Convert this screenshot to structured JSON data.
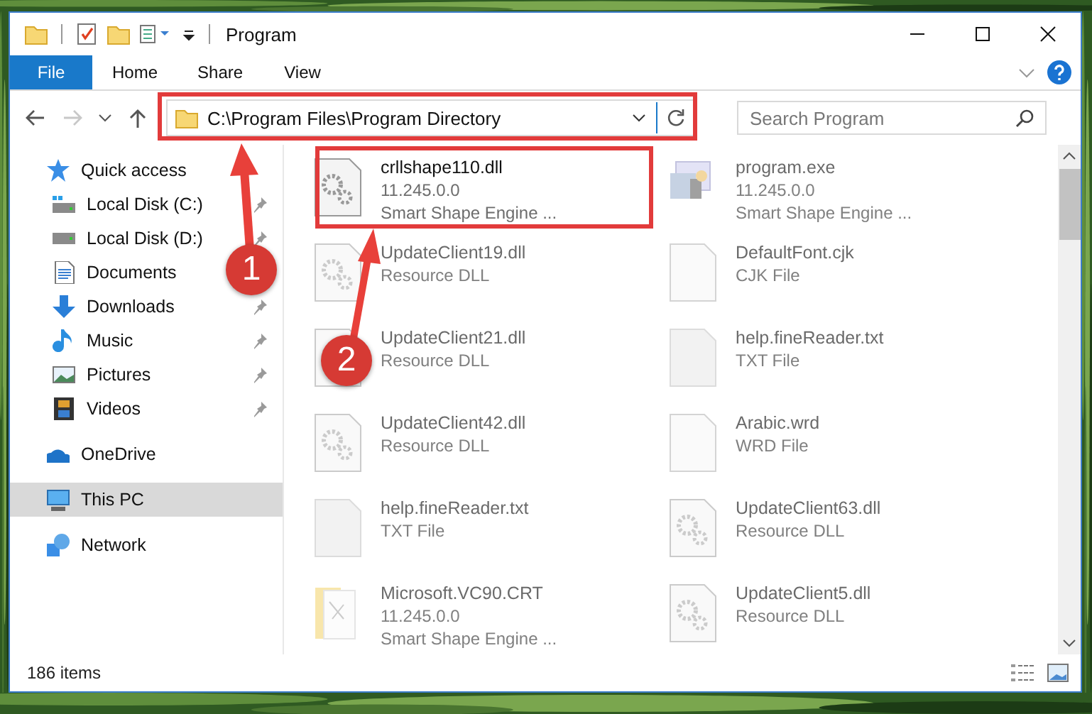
{
  "window": {
    "title": "Program"
  },
  "ribbon": {
    "tabs": [
      {
        "label": "File",
        "selected": true
      },
      {
        "label": "Home",
        "selected": false
      },
      {
        "label": "Share",
        "selected": false
      },
      {
        "label": "View",
        "selected": false
      }
    ]
  },
  "address_bar": {
    "path": "C:\\Program Files\\Program Directory"
  },
  "search": {
    "placeholder": "Search Program"
  },
  "sidebar": {
    "items": [
      {
        "label": "Quick access",
        "kind": "star",
        "selected": false,
        "children": [
          {
            "label": "Local Disk (C:)",
            "kind": "drive-windows",
            "pinned": true,
            "selected": false
          },
          {
            "label": "Local Disk (D:)",
            "kind": "drive",
            "pinned": true,
            "selected": false
          },
          {
            "label": "Documents",
            "kind": "documents",
            "pinned": false,
            "selected": false
          },
          {
            "label": "Downloads",
            "kind": "downloads",
            "pinned": true,
            "selected": false
          },
          {
            "label": "Music",
            "kind": "music",
            "pinned": true,
            "selected": false
          },
          {
            "label": "Pictures",
            "kind": "pictures",
            "pinned": true,
            "selected": false
          },
          {
            "label": "Videos",
            "kind": "videos",
            "pinned": true,
            "selected": false
          }
        ]
      },
      {
        "label": "OneDrive",
        "kind": "cloud",
        "selected": false
      },
      {
        "label": "This PC",
        "kind": "computer",
        "selected": true
      },
      {
        "label": "Network",
        "kind": "network",
        "selected": false
      }
    ]
  },
  "files": [
    {
      "name": "crllshape110.dll",
      "details": [
        "11.245.0.0",
        "Smart Shape Engine ..."
      ],
      "kind": "gear-file",
      "blurred": false
    },
    {
      "name": "program.exe",
      "details": [
        "11.245.0.0",
        "Smart Shape Engine ..."
      ],
      "kind": "program",
      "blurred": true
    },
    {
      "name": "UpdateClient19.dll",
      "details": [
        "Resource DLL"
      ],
      "kind": "gear-file",
      "blurred": true
    },
    {
      "name": "DefaultFont.cjk",
      "details": [
        "CJK File"
      ],
      "kind": "blank-file",
      "blurred": true
    },
    {
      "name": "UpdateClient21.dll",
      "details": [
        "Resource DLL"
      ],
      "kind": "gear-file",
      "blurred": true
    },
    {
      "name": "help.fineReader.txt",
      "details": [
        "TXT File"
      ],
      "kind": "text-file",
      "blurred": true
    },
    {
      "name": "UpdateClient42.dll",
      "details": [
        "Resource DLL"
      ],
      "kind": "gear-file",
      "blurred": true
    },
    {
      "name": "Arabic.wrd",
      "details": [
        "WRD File"
      ],
      "kind": "blank-file",
      "blurred": true
    },
    {
      "name": "help.fineReader.txt",
      "details": [
        "TXT File"
      ],
      "kind": "text-file",
      "blurred": true
    },
    {
      "name": "UpdateClient63.dll",
      "details": [
        "Resource DLL"
      ],
      "kind": "gear-file",
      "blurred": true
    },
    {
      "name": "Microsoft.VC90.CRT",
      "details": [
        "11.245.0.0",
        "Smart Shape Engine ..."
      ],
      "kind": "folder",
      "blurred": true
    },
    {
      "name": "UpdateClient5.dll",
      "details": [
        "Resource DLL"
      ],
      "kind": "gear-file",
      "blurred": true
    }
  ],
  "status_bar": {
    "item_count": "186 items"
  },
  "annotations": [
    {
      "number": "1"
    },
    {
      "number": "2"
    }
  ]
}
